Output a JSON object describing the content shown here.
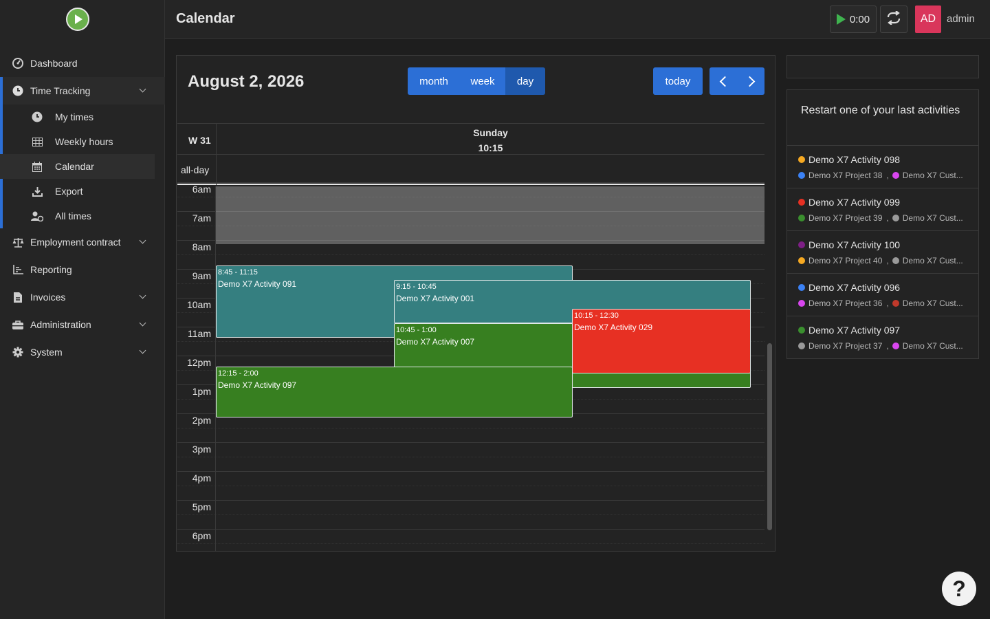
{
  "app": {
    "title": "Calendar",
    "user_initials": "AD",
    "username": "admin",
    "timer": "0:00"
  },
  "sidebar": {
    "items": [
      {
        "label": "Dashboard"
      },
      {
        "label": "Time Tracking"
      },
      {
        "label": "Employment contract"
      },
      {
        "label": "Reporting"
      },
      {
        "label": "Invoices"
      },
      {
        "label": "Administration"
      },
      {
        "label": "System"
      }
    ],
    "sub_items": [
      {
        "label": "My times"
      },
      {
        "label": "Weekly hours"
      },
      {
        "label": "Calendar"
      },
      {
        "label": "Export"
      },
      {
        "label": "All times"
      }
    ]
  },
  "calendar": {
    "date_title": "August 2, 2026",
    "views": [
      "month",
      "week",
      "day"
    ],
    "selected_view": "day",
    "today_label": "today",
    "week_label": "W 31",
    "day_name": "Sunday",
    "day_time": "10:15",
    "allday_label": "all-day",
    "hours": [
      "6am",
      "7am",
      "8am",
      "9am",
      "10am",
      "11am",
      "12pm",
      "1pm",
      "2pm",
      "3pm",
      "4pm",
      "5pm",
      "6pm"
    ],
    "events": [
      {
        "time": "8:45 - 11:15",
        "title": "Demo X7 Activity 091",
        "color": "#357f80"
      },
      {
        "time": "9:15 - 10:45",
        "title": "Demo X7 Activity 001",
        "color": "#357f80"
      },
      {
        "time": "10:15 - 12:30",
        "title": "Demo X7 Activity 029",
        "color": "#e73023"
      },
      {
        "time": "10:45 - 1:00",
        "title": "Demo X7 Activity 007",
        "color": "#377f20"
      },
      {
        "time": "12:15 - 2:00",
        "title": "Demo X7 Activity 097",
        "color": "#377f20"
      }
    ]
  },
  "recent": {
    "title": "Restart one of your last activities",
    "items": [
      {
        "activity": "Demo X7 Activity 098",
        "activity_color": "#f6a922",
        "project": "Demo X7 Project 38",
        "project_color": "#3b82f6",
        "customer": "Demo X7 Cust...",
        "customer_color": "#d946ef"
      },
      {
        "activity": "Demo X7 Activity 099",
        "activity_color": "#e73023",
        "project": "Demo X7 Project 39",
        "project_color": "#3a8f2e",
        "customer": "Demo X7 Cust...",
        "customer_color": "#9a9a9a"
      },
      {
        "activity": "Demo X7 Activity 100",
        "activity_color": "#7e1f86",
        "project": "Demo X7 Project 40",
        "project_color": "#f6a922",
        "customer": "Demo X7 Cust...",
        "customer_color": "#9a9a9a"
      },
      {
        "activity": "Demo X7 Activity 096",
        "activity_color": "#3b82f6",
        "project": "Demo X7 Project 36",
        "project_color": "#d946ef",
        "customer": "Demo X7 Cust...",
        "customer_color": "#c0392b"
      },
      {
        "activity": "Demo X7 Activity 097",
        "activity_color": "#3a8f2e",
        "project": "Demo X7 Project 37",
        "project_color": "#9a9a9a",
        "customer": "Demo X7 Cust...",
        "customer_color": "#d946ef"
      }
    ]
  },
  "help": {
    "label": "?"
  }
}
